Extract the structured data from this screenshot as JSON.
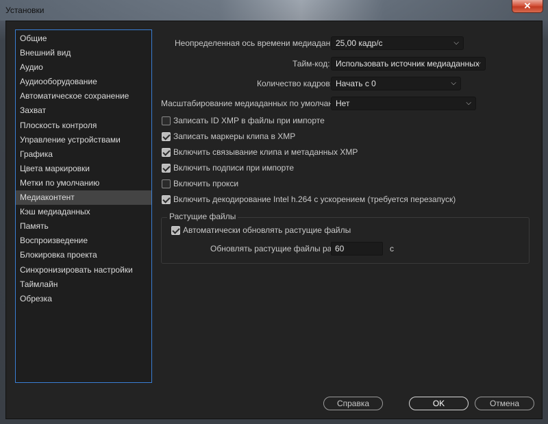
{
  "window": {
    "title": "Установки",
    "close_glyph": "✕"
  },
  "sidebar": {
    "items": [
      {
        "label": "Общие"
      },
      {
        "label": "Внешний вид"
      },
      {
        "label": "Аудио"
      },
      {
        "label": "Аудиооборудование"
      },
      {
        "label": "Автоматическое сохранение"
      },
      {
        "label": "Захват"
      },
      {
        "label": "Плоскость контроля"
      },
      {
        "label": "Управление устройствами"
      },
      {
        "label": "Графика"
      },
      {
        "label": "Цвета маркировки"
      },
      {
        "label": "Метки по умолчанию"
      },
      {
        "label": "Медиаконтент"
      },
      {
        "label": "Кэш медиаданных"
      },
      {
        "label": "Память"
      },
      {
        "label": "Воспроизведение"
      },
      {
        "label": "Блокировка проекта"
      },
      {
        "label": "Синхронизировать настройки"
      },
      {
        "label": "Таймлайн"
      },
      {
        "label": "Обрезка"
      }
    ],
    "selected": "Медиаконтент"
  },
  "settings": {
    "timebase": {
      "label": "Неопределенная ось времени медиаданных:",
      "value": "25,00 кадр/с"
    },
    "timecode": {
      "label": "Тайм-код:",
      "value": "Использовать источник медиаданных"
    },
    "frame_count": {
      "label": "Количество кадров:",
      "value": "Начать с 0"
    },
    "scaling": {
      "label": "Масштабирование медиаданных по умолчанию:",
      "value": "Нет"
    }
  },
  "checkboxes": [
    {
      "label": "Записать ID XMP в файлы при импорте",
      "checked": false
    },
    {
      "label": "Записать маркеры клипа в XMP",
      "checked": true
    },
    {
      "label": "Включить связывание клипа и метаданных XMP",
      "checked": true
    },
    {
      "label": "Включить подписи при импорте",
      "checked": true
    },
    {
      "label": "Включить прокси",
      "checked": false
    },
    {
      "label": "Включить декодирование Intel h.264 с ускорением (требуется перезапуск)",
      "checked": true
    }
  ],
  "growing_files": {
    "title": "Растущие файлы",
    "auto_refresh": {
      "label": "Автоматически обновлять растущие файлы",
      "checked": true
    },
    "refresh_label": "Обновлять растущие файлы раз в",
    "refresh_value": "60",
    "unit": "с"
  },
  "buttons": {
    "help": "Справка",
    "ok": "OK",
    "cancel": "Отмена"
  },
  "icons": {
    "dropdown": "chevron-down-icon",
    "checkbox_check": "check-icon"
  }
}
